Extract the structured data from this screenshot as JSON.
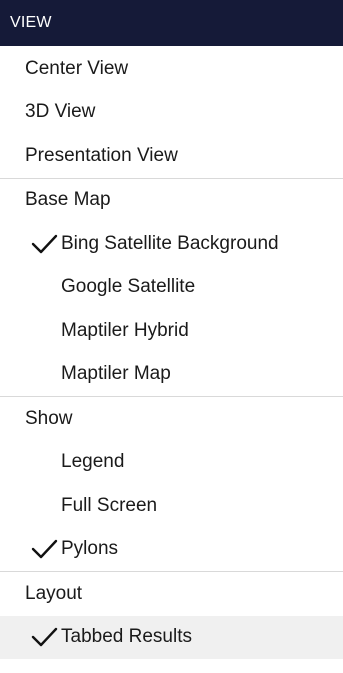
{
  "header": {
    "title": "VIEW"
  },
  "sections": {
    "view": {
      "items": [
        {
          "label": "Center View"
        },
        {
          "label": "3D View"
        },
        {
          "label": "Presentation View"
        }
      ]
    },
    "base_map": {
      "heading": "Base Map",
      "items": [
        {
          "label": "Bing Satellite Background",
          "checked": true
        },
        {
          "label": "Google Satellite",
          "checked": false
        },
        {
          "label": "Maptiler Hybrid",
          "checked": false
        },
        {
          "label": "Maptiler Map",
          "checked": false
        }
      ]
    },
    "show": {
      "heading": "Show",
      "items": [
        {
          "label": "Legend",
          "checked": false
        },
        {
          "label": "Full Screen",
          "checked": false
        },
        {
          "label": "Pylons",
          "checked": true
        }
      ]
    },
    "layout": {
      "heading": "Layout",
      "items": [
        {
          "label": "Tabbed Results",
          "checked": true
        }
      ]
    }
  },
  "icons": {
    "check": "checkmark-icon"
  },
  "colors": {
    "header_bg": "#151a38",
    "header_text": "#ffffff",
    "hover_bg": "#f0f0f0"
  }
}
